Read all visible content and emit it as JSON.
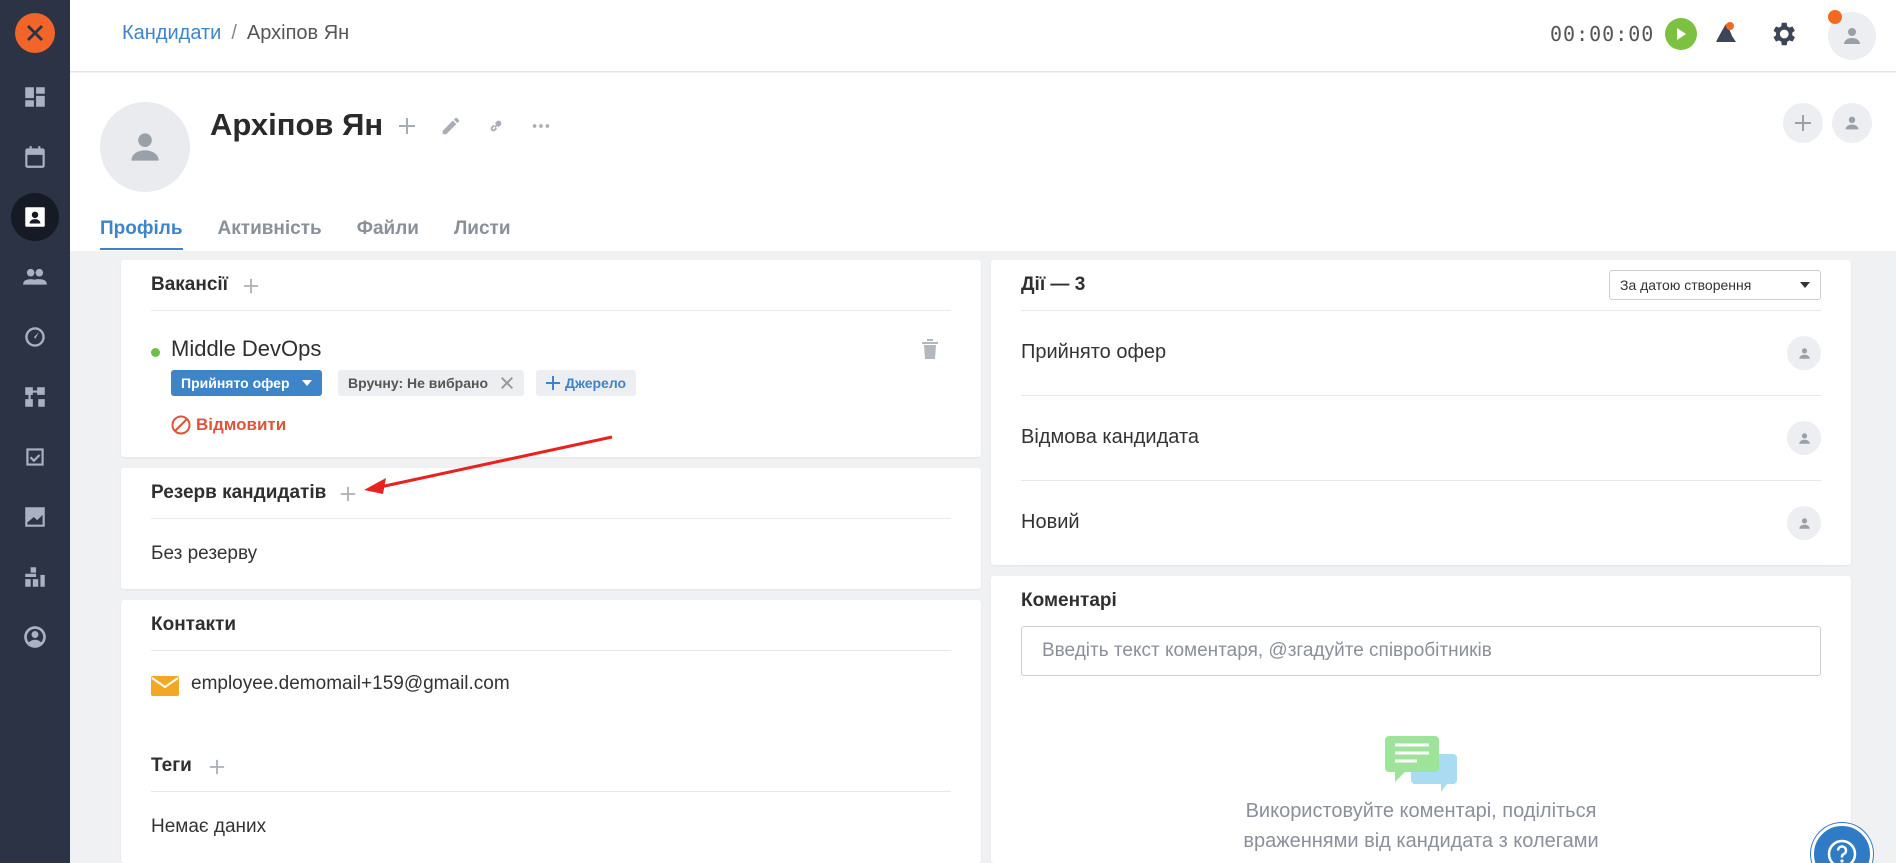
{
  "sidebar": {
    "logo_icon": "x-logo-icon",
    "items": [
      {
        "icon": "dashboard-icon",
        "active": false
      },
      {
        "icon": "calendar-icon",
        "active": false
      },
      {
        "icon": "candidates-icon",
        "active": true
      },
      {
        "icon": "team-icon",
        "active": false
      },
      {
        "icon": "speedometer-icon",
        "active": false
      },
      {
        "icon": "workflow-icon",
        "active": false
      },
      {
        "icon": "tasks-icon",
        "active": false
      },
      {
        "icon": "analytics-icon",
        "active": false
      },
      {
        "icon": "integrations-icon",
        "active": false
      },
      {
        "icon": "profile-icon",
        "active": false
      }
    ]
  },
  "topbar": {
    "breadcrumb_root": "Кандидати",
    "breadcrumb_sep": "/",
    "breadcrumb_current": "Архіпов Ян",
    "timer": "00:00:00"
  },
  "candidate": {
    "name": "Архіпов Ян",
    "tabs": [
      "Профіль",
      "Активність",
      "Файли",
      "Листи"
    ],
    "active_tab": "Профіль"
  },
  "vacancies": {
    "title": "Вакансії",
    "vacancy_name": "Middle DevOps",
    "status_label": "Прийнято офер",
    "source_manual": "Вручну: Не вибрано",
    "source_add": "Джерело",
    "reject_label": "Відмовити"
  },
  "reserve": {
    "title": "Резерв кандидатів",
    "empty": "Без резерву"
  },
  "contacts": {
    "title": "Контакти",
    "email": "employee.demomail+159@gmail.com"
  },
  "tags": {
    "title": "Теги",
    "empty": "Немає даних"
  },
  "actions": {
    "title": "Дії — 3",
    "sort_label": "За датою створення",
    "items": [
      "Прийнято офер",
      "Відмова кандидата",
      "Новий"
    ]
  },
  "comments": {
    "title": "Коментарі",
    "placeholder": "Введіть текст коментаря, @згадуйте співробітників",
    "hint_line1": "Використовуйте коментарі, поділіться",
    "hint_line2": "враженнями від кандидата з колегами"
  },
  "colors": {
    "accent": "#3d84c8",
    "sidebar": "#2b3345",
    "brand": "#f1652a",
    "danger": "#e0533b",
    "success": "#7cc142"
  }
}
